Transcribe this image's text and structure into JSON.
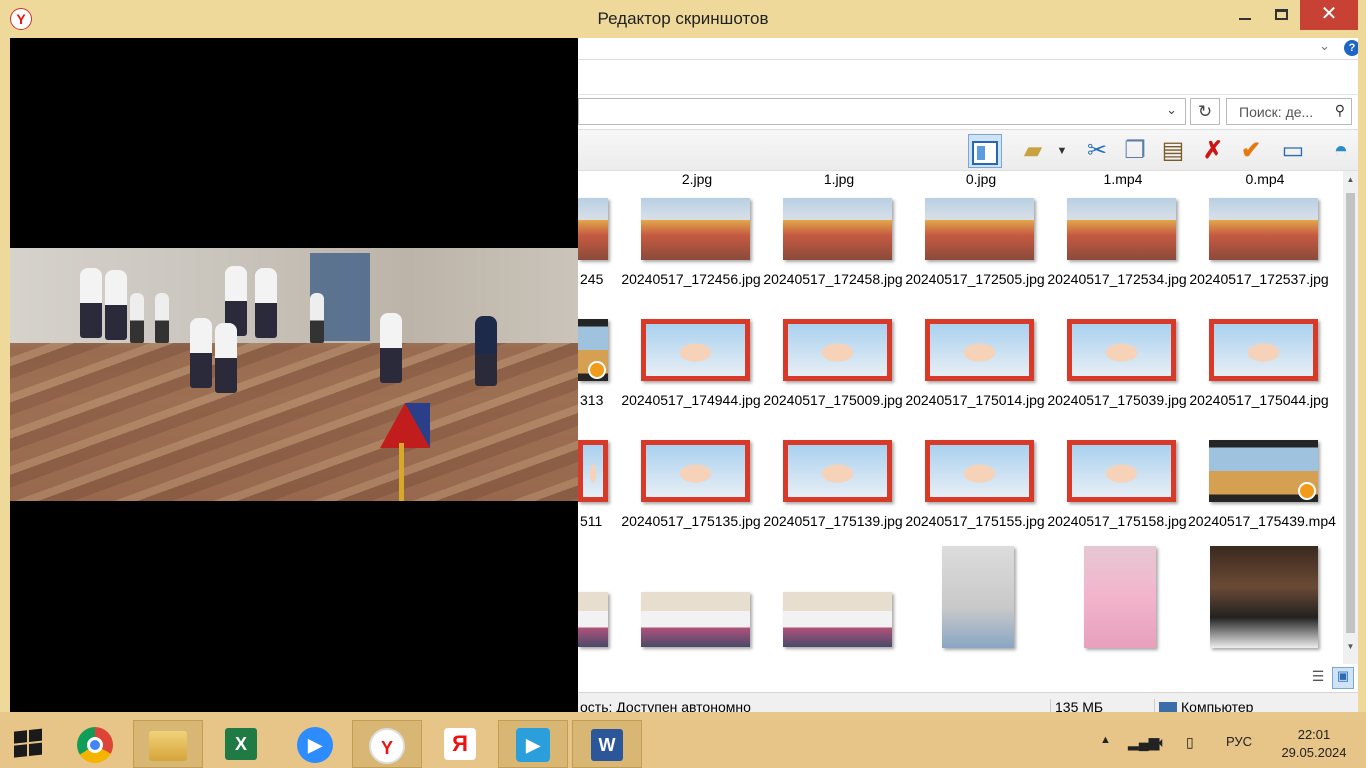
{
  "window": {
    "title": "Редактор скриншотов",
    "app_icon": "yandex-browser-icon"
  },
  "explorer": {
    "search_placeholder": "Поиск: де...",
    "toolbar_icons": [
      "view-pane-icon",
      "folder-check-icon",
      "cut-icon",
      "copy-icon",
      "paste-icon",
      "delete-icon",
      "check-icon",
      "properties-icon",
      "shell-icon"
    ],
    "top_row_names": [
      "2.jpg",
      "1.jpg",
      "0.jpg",
      "1.mp4",
      "0.mp4"
    ],
    "rows": [
      {
        "partial_name": "245",
        "items": [
          {
            "name": "20240517_172456.jpg",
            "type": "hall"
          },
          {
            "name": "20240517_172458.jpg",
            "type": "hall"
          },
          {
            "name": "20240517_172505.jpg",
            "type": "hall"
          },
          {
            "name": "20240517_172534.jpg",
            "type": "hall"
          },
          {
            "name": "20240517_172537.jpg",
            "type": "hall"
          }
        ]
      },
      {
        "partial_name": "313",
        "items": [
          {
            "name": "20240517_174944.jpg",
            "type": "frame"
          },
          {
            "name": "20240517_175009.jpg",
            "type": "frame"
          },
          {
            "name": "20240517_175014.jpg",
            "type": "frame"
          },
          {
            "name": "20240517_175039.jpg",
            "type": "frame"
          },
          {
            "name": "20240517_175044.jpg",
            "type": "frame"
          }
        ]
      },
      {
        "partial_name": "511",
        "items": [
          {
            "name": "20240517_175135.jpg",
            "type": "frame"
          },
          {
            "name": "20240517_175139.jpg",
            "type": "frame"
          },
          {
            "name": "20240517_175155.jpg",
            "type": "frame"
          },
          {
            "name": "20240517_175158.jpg",
            "type": "frame"
          },
          {
            "name": "20240517_175439.mp4",
            "type": "video"
          }
        ]
      }
    ],
    "status": {
      "state": "ость: Доступен автономно",
      "size": "135 МБ",
      "location": "Компьютер"
    }
  },
  "taskbar": {
    "apps": [
      "start",
      "chrome",
      "file-explorer",
      "excel",
      "zoom",
      "yandex-browser",
      "yandex",
      "media-player",
      "word"
    ],
    "language": "РУС",
    "time": "22:01",
    "date": "29.05.2024"
  },
  "colors": {
    "titlebar": "#eed99b",
    "taskbar": "#e7c488",
    "close_button": "#c74135"
  }
}
